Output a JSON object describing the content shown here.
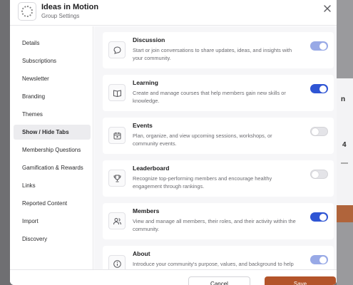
{
  "header": {
    "title": "Ideas in Motion",
    "subtitle": "Group Settings"
  },
  "sidebar": {
    "items": [
      {
        "label": "Details"
      },
      {
        "label": "Subscriptions"
      },
      {
        "label": "Newsletter"
      },
      {
        "label": "Branding"
      },
      {
        "label": "Themes"
      },
      {
        "label": "Show / Hide Tabs",
        "active": true
      },
      {
        "label": "Membership Questions"
      },
      {
        "label": "Gamification & Rewards"
      },
      {
        "label": "Links"
      },
      {
        "label": "Reported Content"
      },
      {
        "label": "Import"
      },
      {
        "label": "Discovery"
      }
    ]
  },
  "tabs": [
    {
      "title": "Discussion",
      "description": "Start or join conversations to share updates, ideas, and insights with your community.",
      "icon": "discussion-icon",
      "enabled": true,
      "locked": true
    },
    {
      "title": "Learning",
      "description": "Create and manage courses that help members gain new skills or knowledge.",
      "icon": "book-icon",
      "enabled": true,
      "locked": false
    },
    {
      "title": "Events",
      "description": "Plan, organize, and view upcoming sessions, workshops, or community events.",
      "icon": "calendar-icon",
      "enabled": false,
      "locked": false
    },
    {
      "title": "Leaderboard",
      "description": "Recognize top-performing members and encourage healthy engagement through rankings.",
      "icon": "trophy-icon",
      "enabled": false,
      "locked": false
    },
    {
      "title": "Members",
      "description": "View and manage all members, their roles, and their activity within the community.",
      "icon": "members-icon",
      "enabled": true,
      "locked": false
    },
    {
      "title": "About",
      "description": "Introduce your community's purpose, values, and background to help",
      "icon": "info-icon",
      "enabled": true,
      "locked": true
    }
  ],
  "footer": {
    "cancel_label": "Cancel",
    "save_label": "Save"
  },
  "colors": {
    "accent": "#2f55d4",
    "accent_light": "#98a9e6",
    "save_button": "#b3542a"
  }
}
